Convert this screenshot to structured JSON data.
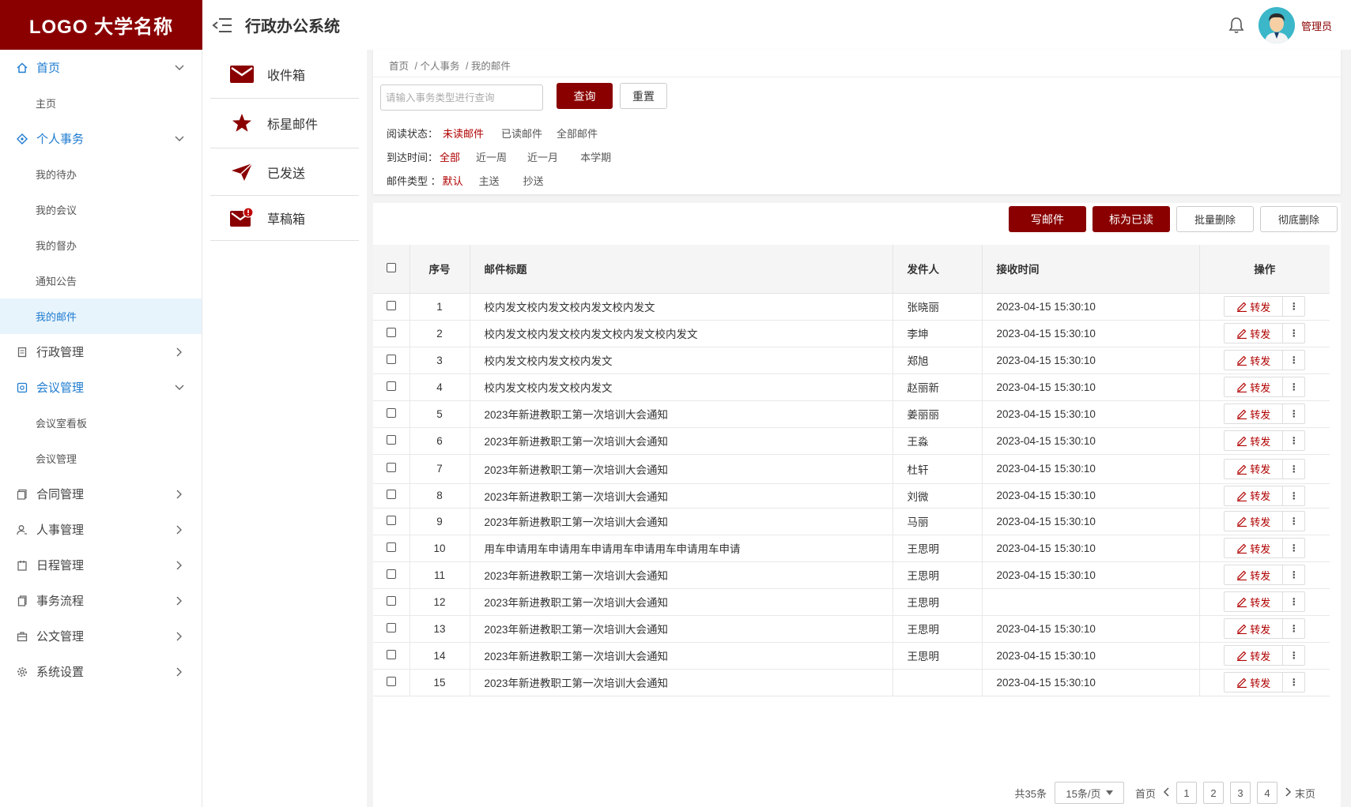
{
  "logo_text": "LOGO 大学名称",
  "app_title": "行政办公系统",
  "user_name": "管理员",
  "sidebar": {
    "nav_home": "首页",
    "sub_home": "主页",
    "nav_personal": "个人事务",
    "sub_todo": "我的待办",
    "sub_meeting": "我的会议",
    "sub_supervise": "我的督办",
    "sub_notice": "通知公告",
    "sub_mail": "我的邮件",
    "nav_admin": "行政管理",
    "nav_meeting": "会议管理",
    "sub_room_board": "会议室看板",
    "sub_meeting_mgmt": "会议管理",
    "nav_contract": "合同管理",
    "nav_hr": "人事管理",
    "nav_schedule": "日程管理",
    "nav_workflow": "事务流程",
    "nav_document": "公文管理",
    "nav_settings": "系统设置"
  },
  "folders": {
    "inbox": "收件箱",
    "starred": "标星邮件",
    "sent": "已发送",
    "drafts": "草稿箱"
  },
  "breadcrumb": [
    "首页",
    "/ 个人事务",
    "/ 我的邮件"
  ],
  "search": {
    "placeholder": "请输入事务类型进行查询",
    "query_label": "查询",
    "reset_label": "重置"
  },
  "filters": {
    "read_label": "阅读状态：",
    "read_unread": "未读邮件",
    "read_read": "已读邮件",
    "read_all": "全部邮件",
    "time_label": "到达时间：",
    "time_all": "全部",
    "time_week": "近一周",
    "time_month": "近一月",
    "time_term": "本学期",
    "type_label": "邮件类型 ：",
    "type_default": "默认",
    "type_main": "主送",
    "type_cc": "抄送"
  },
  "toolbar": {
    "compose": "写邮件",
    "mark_read": "标为已读",
    "batch_delete": "批量删除",
    "purge": "彻底删除"
  },
  "table": {
    "headers": {
      "index": "序号",
      "title": "邮件标题",
      "sender": "发件人",
      "time": "接收时间",
      "action": "操作"
    },
    "forward_label": "转发",
    "rows": [
      {
        "index": "1",
        "title": "校内发文校内发文校内发文校内发文",
        "sender": "张晓丽",
        "time": "2023-04-15 15:30:10"
      },
      {
        "index": "2",
        "title": "校内发文校内发文校内发文校内发文校内发文",
        "sender": "李坤",
        "time": "2023-04-15 15:30:10"
      },
      {
        "index": "3",
        "title": "校内发文校内发文校内发文",
        "sender": "郑旭",
        "time": "2023-04-15 15:30:10"
      },
      {
        "index": "4",
        "title": "校内发文校内发文校内发文",
        "sender": "赵丽新",
        "time": "2023-04-15 15:30:10"
      },
      {
        "index": "5",
        "title": "2023年新进教职工第一次培训大会通知",
        "sender": "姜丽丽",
        "time": "2023-04-15 15:30:10"
      },
      {
        "index": "6",
        "title": "2023年新进教职工第一次培训大会通知",
        "sender": "王淼",
        "time": "2023-04-15 15:30:10"
      },
      {
        "index": "7",
        "title": "2023年新进教职工第一次培训大会通知",
        "sender": "杜轩",
        "time": "2023-04-15 15:30:10"
      },
      {
        "index": "8",
        "title": "2023年新进教职工第一次培训大会通知",
        "sender": "刘微",
        "time": "2023-04-15 15:30:10"
      },
      {
        "index": "9",
        "title": "2023年新进教职工第一次培训大会通知",
        "sender": "马丽",
        "time": "2023-04-15 15:30:10"
      },
      {
        "index": "10",
        "title": "用车申请用车申请用车申请用车申请用车申请用车申请",
        "sender": "王思明",
        "time": "2023-04-15 15:30:10"
      },
      {
        "index": "11",
        "title": "2023年新进教职工第一次培训大会通知",
        "sender": "王思明",
        "time": "2023-04-15 15:30:10"
      },
      {
        "index": "12",
        "title": "2023年新进教职工第一次培训大会通知",
        "sender": "王思明",
        "time": ""
      },
      {
        "index": "13",
        "title": "2023年新进教职工第一次培训大会通知",
        "sender": "王思明",
        "time": "2023-04-15 15:30:10"
      },
      {
        "index": "14",
        "title": "2023年新进教职工第一次培训大会通知",
        "sender": "王思明",
        "time": "2023-04-15 15:30:10"
      },
      {
        "index": "15",
        "title": "2023年新进教职工第一次培训大会通知",
        "sender": "",
        "time": "2023-04-15 15:30:10"
      }
    ]
  },
  "pagination": {
    "total": "共35条",
    "page_size": "15条/页",
    "first": "首页",
    "pages": [
      "1",
      "2",
      "3",
      "4"
    ],
    "last": "末页"
  },
  "colors": {
    "brand": "#8a0000",
    "accent_blue": "#1e7bd0",
    "selected_red": "#b00000"
  }
}
